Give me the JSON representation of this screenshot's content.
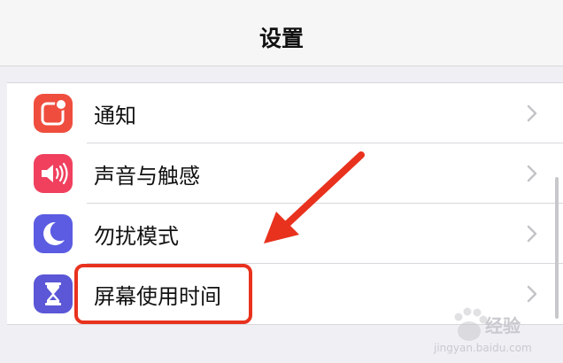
{
  "nav": {
    "title": "设置"
  },
  "settings": {
    "items": [
      {
        "label": "通知",
        "icon": "notifications-icon",
        "color": "#ef4d3e"
      },
      {
        "label": "声音与触感",
        "icon": "sound-icon",
        "color": "#f0405e"
      },
      {
        "label": "勿扰模式",
        "icon": "moon-icon",
        "color": "#5b5ce2"
      },
      {
        "label": "屏幕使用时间",
        "icon": "hourglass-icon",
        "color": "#5b57d6"
      }
    ]
  },
  "annotation": {
    "highlight_color": "#e8321e"
  },
  "watermark": {
    "text": "经验",
    "url": "jingyan.baidu.com"
  }
}
